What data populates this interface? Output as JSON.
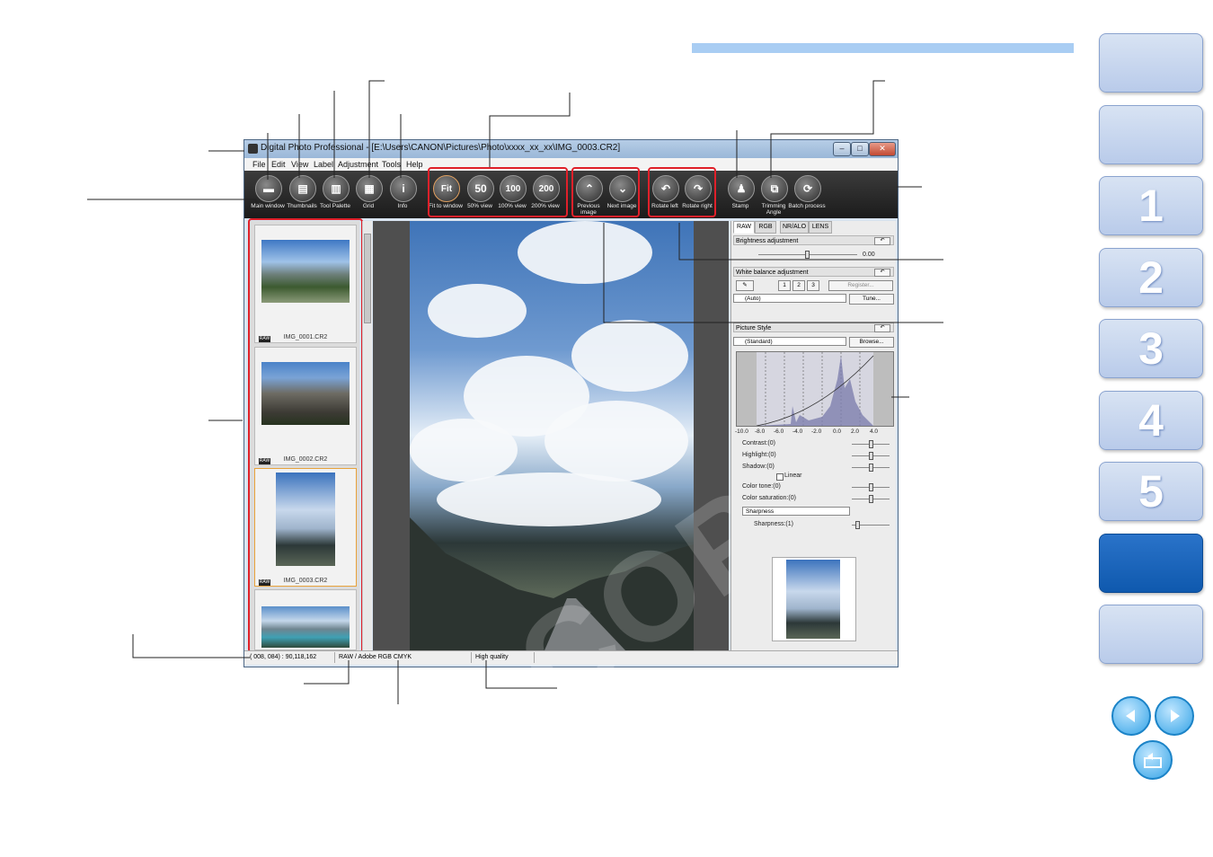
{
  "window": {
    "title": "Digital Photo Professional - [E:\\Users\\CANON\\Pictures\\Photo\\xxxx_xx_xx\\IMG_0003.CR2]",
    "controls": {
      "minimize": "–",
      "maximize": "□",
      "close": "✕"
    }
  },
  "menu": [
    "File",
    "Edit",
    "View",
    "Label",
    "Adjustment",
    "Tools",
    "Help"
  ],
  "toolbar": {
    "main_window": "Main window",
    "thumbnails": "Thumbnails",
    "tool_palette": "Tool Palette",
    "grid": "Grid",
    "info": "Info",
    "fit_to_window": "Fit to window",
    "fit_glyph": "Fit",
    "view_50": "50% view",
    "view_50_glyph": "50",
    "view_100": "100% view",
    "view_100_glyph": "100",
    "view_200": "200% view",
    "view_200_glyph": "200",
    "previous_image": "Previous image",
    "next_image": "Next image",
    "rotate_left": "Rotate left",
    "rotate_right": "Rotate right",
    "stamp": "Stamp",
    "trimming_angle": "Trimming Angle",
    "batch_process": "Batch process"
  },
  "thumbnails": [
    {
      "name": "IMG_0001.CR2",
      "badge": "RAW"
    },
    {
      "name": "IMG_0002.CR2",
      "badge": "RAW"
    },
    {
      "name": "IMG_0003.CR2",
      "badge": "RAW"
    }
  ],
  "watermark": "COPY",
  "palette": {
    "tabs": [
      "RAW",
      "RGB",
      "NR/ALO",
      "LENS"
    ],
    "brightness": {
      "label": "Brightness adjustment",
      "value": "0.00"
    },
    "white_balance": {
      "label": "White balance adjustment",
      "presets": [
        "1",
        "2",
        "3"
      ],
      "register": "Register...",
      "mode": "(Auto)",
      "tune": "Tune..."
    },
    "picture_style": {
      "label": "Picture Style",
      "style": "(Standard)",
      "browse": "Browse..."
    },
    "histogram_ticks": [
      "-10.0",
      "-8.0",
      "-6.0",
      "-4.0",
      "-2.0",
      "0.0",
      "2.0",
      "4.0"
    ],
    "contrast": "Contrast:(0)",
    "highlight": "Highlight:(0)",
    "shadow": "Shadow:(0)",
    "linear": "Linear",
    "color_tone": "Color tone:(0)",
    "color_saturation": "Color saturation:(0)",
    "sharpness_select": "Sharpness",
    "sharpness": "Sharpness:(1)",
    "undo_glyph": "↶"
  },
  "statusbar": {
    "coords": "( 008, 084) : 90,118,162",
    "colorspace": "RAW / Adobe RGB  CMYK",
    "quality": "High quality"
  },
  "side_tabs": [
    "",
    "",
    "1",
    "2",
    "3",
    "4",
    "5",
    "",
    ""
  ],
  "nav": {
    "prev": "◀",
    "next": "▶",
    "back": "↩"
  }
}
